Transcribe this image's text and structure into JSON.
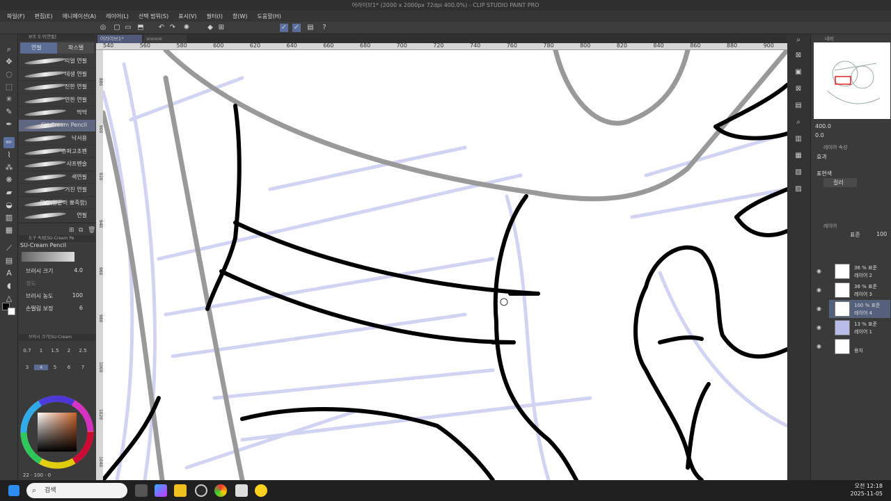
{
  "window": {
    "title": "어라이브1* (2000 x 2000px 72dpi 400.0%) - CLIP STUDIO PAINT PRO"
  },
  "menu": [
    "파일(F)",
    "편집(E)",
    "애니메이션(A)",
    "레이어(L)",
    "선택 범위(S)",
    "표시(V)",
    "필터(I)",
    "창(W)",
    "도움말(H)"
  ],
  "subtool_panel": {
    "header": "보조 도구[연필]",
    "tabs": [
      "연필",
      "파스텔"
    ],
    "brushes": [
      "리얼 연필",
      "데생 연필",
      "진한 연필",
      "연한 연필",
      "딱딱",
      "SU-Cream Pencil",
      "낙서용",
      "슈퍼고초펜",
      "샤프펜슬",
      "색연필",
      "거친 연필",
      "연필(양끝이 뾰족함)",
      "연필"
    ],
    "selected_brush": "SU-Cream Pencil"
  },
  "tool_property": {
    "header": "도구 속성[SU-Cream Pe",
    "brush_name": "SU-Cream Pencil",
    "rows": [
      {
        "label": "브러시 크기",
        "value": "4.0"
      },
      {
        "label": "경도",
        "value": ""
      },
      {
        "label": "브러시 농도",
        "value": "100"
      },
      {
        "label": "손떨림 보정",
        "value": "6"
      }
    ]
  },
  "brush_size_panel": {
    "header": "브러시 크기[SU-Cream",
    "sizes": [
      "0.7",
      "1",
      "1.5",
      "2",
      "2.5",
      "3",
      "4",
      "5",
      "6",
      "7"
    ]
  },
  "color_readout": {
    "a": "22",
    "b": "100",
    "c": "0"
  },
  "document": {
    "tabs": [
      "어라이브1*",
      "wwww"
    ],
    "ruler_ticks": [
      "540",
      "560",
      "580",
      "600",
      "620",
      "640",
      "660",
      "680",
      "700",
      "720",
      "740",
      "760",
      "780",
      "800",
      "820",
      "840",
      "860",
      "880",
      "900"
    ],
    "vruler_ticks": [
      "880",
      "900",
      "920",
      "940",
      "960",
      "980",
      "1000",
      "1020",
      "1040"
    ]
  },
  "navigator": {
    "header": "내비",
    "zoom": "400.0",
    "angle": "0.0"
  },
  "layer_property": {
    "header": "레이어 속성",
    "effect_label": "효과",
    "expression_label": "표현색",
    "expression_value": "컬러"
  },
  "layers": {
    "header": "레이어",
    "blend": "표준",
    "opacity": "100",
    "items": [
      {
        "percent": "36 % 표준",
        "name": "레이어 2"
      },
      {
        "percent": "36 % 표준",
        "name": "레이어 3"
      },
      {
        "percent": "100 % 표준",
        "name": "레이어 4"
      },
      {
        "percent": "13 % 표준",
        "name": "레이어 1"
      },
      {
        "percent": "",
        "name": "용지"
      }
    ],
    "selected": "레이어 4"
  },
  "taskbar": {
    "search_placeholder": "검색",
    "time": "오전 12:18",
    "date": "2025-11-05"
  },
  "colors": {
    "accent": "#5b6d95",
    "sketch": "#c8ccf0"
  }
}
